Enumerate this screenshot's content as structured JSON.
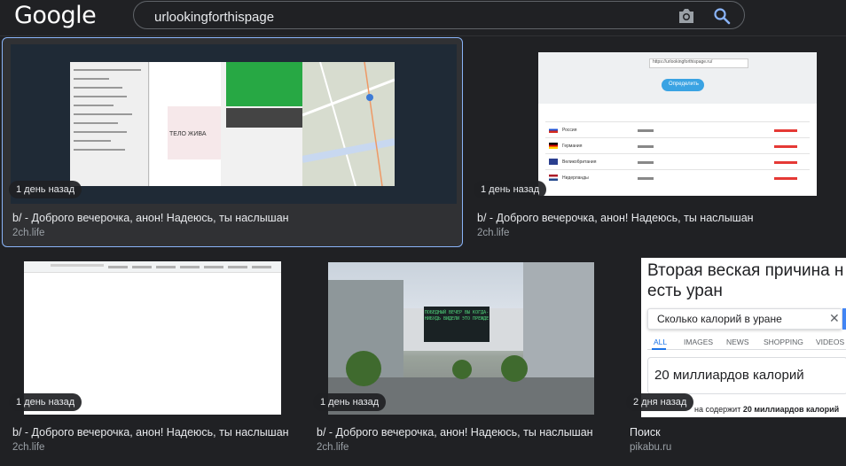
{
  "header": {
    "logo": "Google",
    "query": "urlookingforthispage"
  },
  "results": [
    {
      "badge": "1 день назад",
      "title": "b/ - Доброго вечерочка, анон! Надеюсь, ты наслышан",
      "source": "2ch.life",
      "selected": true
    },
    {
      "badge": "1 день назад",
      "title": "b/ - Доброго вечерочка, анон! Надеюсь, ты наслышан",
      "source": "2ch.life",
      "selected": false
    },
    {
      "badge": "1 день назад",
      "title": "b/ - Доброго вечерочка, анон! Надеюсь, ты наслышан",
      "source": "2ch.life",
      "selected": false
    },
    {
      "badge": "1 день назад",
      "title": "b/ - Доброго вечерочка, анон! Надеюсь, ты наслышан",
      "source": "2ch.life",
      "selected": false
    },
    {
      "badge": "2 дня назад",
      "title": "Поиск",
      "source": "pikabu.ru",
      "selected": false
    }
  ],
  "thumb1": {
    "shop_text": "ТЕЛО ЖИВА"
  },
  "thumb2": {
    "url_field": "https://urlookingforthispage.ru/",
    "button": "Определить",
    "rows": [
      "Россия",
      "Германия",
      "Великобритания",
      "Нидерланды"
    ]
  },
  "thumb4": {
    "screen_text": "ПОБЕДНЫЙ ВЕЧЕР ВЫ КОГДА-НИБУДЬ ВИДЕЛИ ЭТО ПРЕЖДЕ"
  },
  "thumb5": {
    "heading_line1": "Вторая веская причина н",
    "heading_line2": "есть уран",
    "search_text": "Сколько калорий в уране",
    "close": "✕",
    "tabs": [
      "ALL",
      "IMAGES",
      "NEWS",
      "SHOPPING",
      "VIDEOS"
    ],
    "answer": "20 миллиардов калорий",
    "footer_prefix": "на содержит ",
    "footer_bold": "20 миллиардов калорий"
  }
}
